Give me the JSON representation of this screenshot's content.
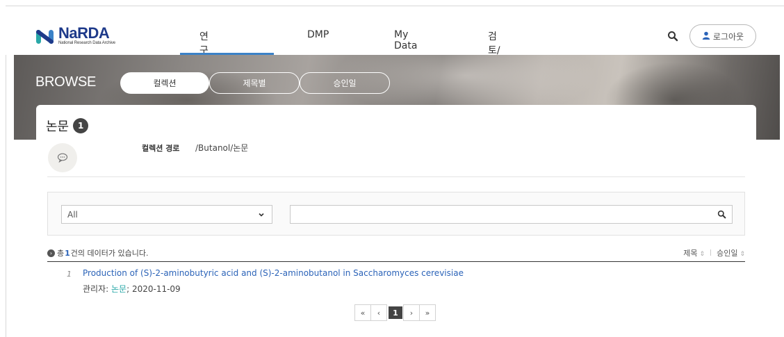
{
  "logo": {
    "title": "NaRDA",
    "subtitle": "National Research Data Archive"
  },
  "nav": {
    "items": [
      "연구데이터",
      "DMP",
      "My Data",
      "검토/승인"
    ],
    "active_index": 0
  },
  "header": {
    "logout_label": "로그아웃"
  },
  "banner": {
    "title": "BROWSE",
    "tabs": [
      {
        "label": "컬렉션",
        "active": true
      },
      {
        "label": "제목별",
        "active": false
      },
      {
        "label": "승인일",
        "active": false
      }
    ]
  },
  "collection": {
    "title": "논문",
    "count": "1",
    "path_label": "컬렉션 경로",
    "path_value": "/Butanol/논문"
  },
  "filter": {
    "select_value": "All",
    "search_value": ""
  },
  "summary": {
    "prefix": "총",
    "count": "1",
    "suffix": "건의 데이터가 있습니다."
  },
  "sort": {
    "options": [
      "제목",
      "승인일"
    ]
  },
  "results": [
    {
      "num": "1",
      "title": "Production of (S)-2-aminobutyric acid and (S)-2-aminobutanol in Saccharomyces cerevisiae",
      "manager_label": "관리자:",
      "category": "논문",
      "date": "; 2020-11-09"
    }
  ],
  "pagination": {
    "first": "«",
    "prev": "‹",
    "current": "1",
    "next": "›",
    "last": "»"
  },
  "colors": {
    "brand": "#1e3a8a",
    "accent": "#3b82c8",
    "link": "#2b63b8",
    "teal": "#2aa8a8"
  }
}
